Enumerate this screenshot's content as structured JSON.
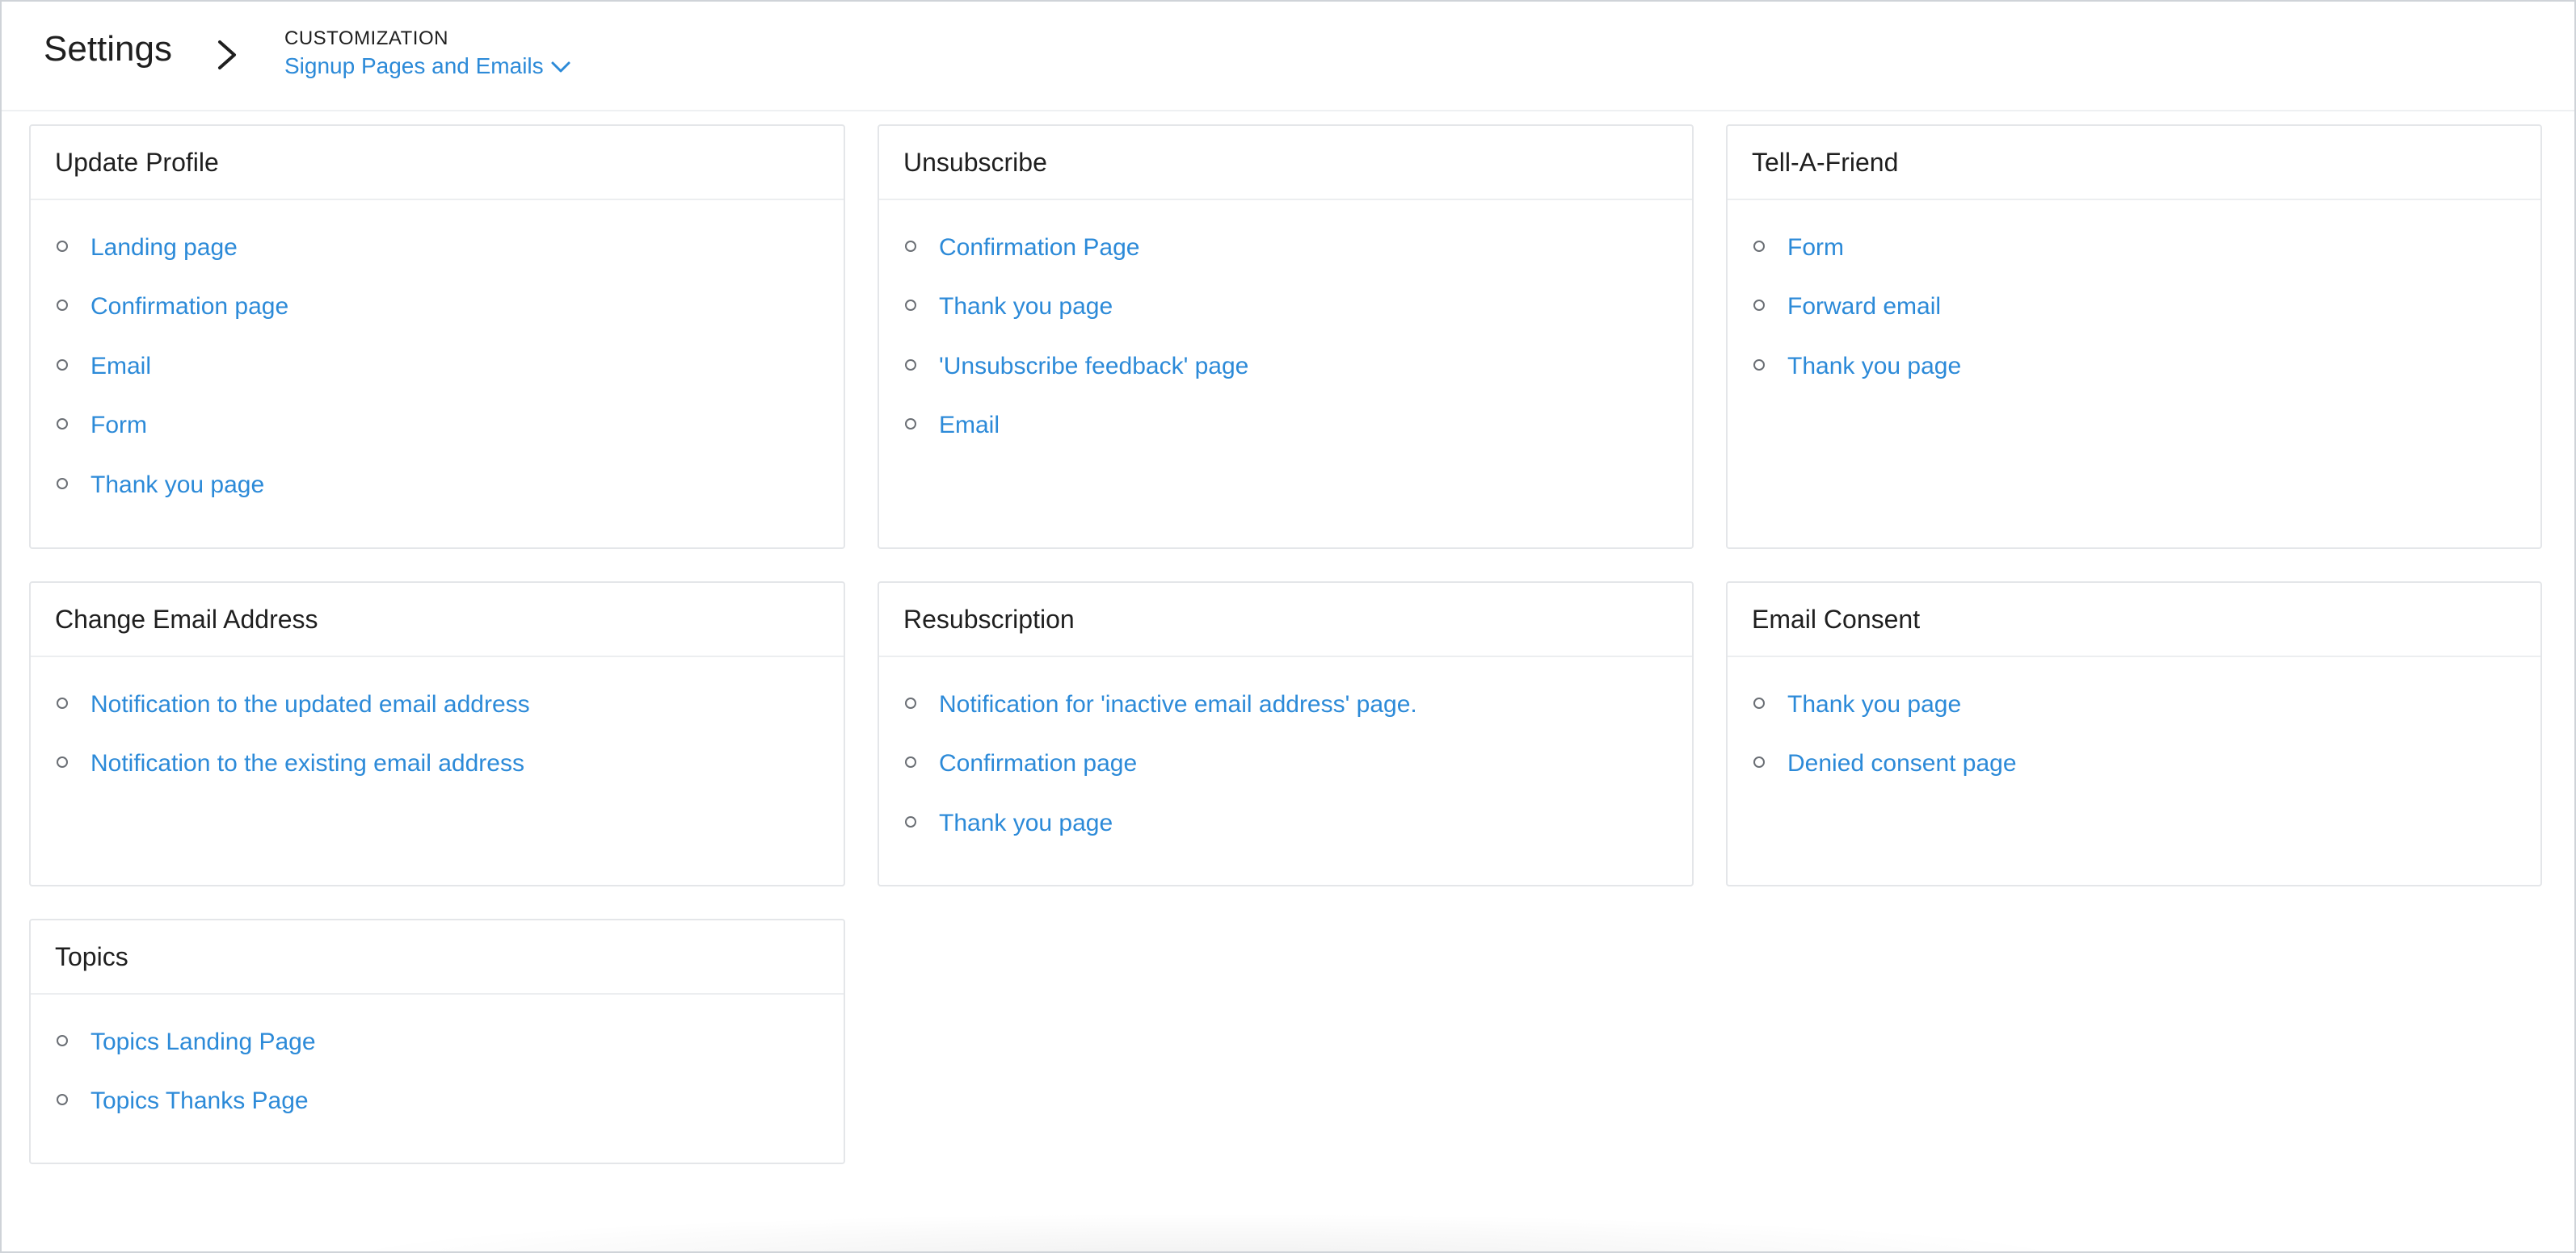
{
  "header": {
    "title": "Settings",
    "breadcrumb_section": "CUSTOMIZATION",
    "breadcrumb_current": "Signup Pages and Emails"
  },
  "accent_color": "#2c8ad8",
  "cards": [
    {
      "title": "Update Profile",
      "items": [
        "Landing page",
        "Confirmation page",
        "Email",
        "Form",
        "Thank you page"
      ]
    },
    {
      "title": "Unsubscribe",
      "items": [
        "Confirmation Page",
        "Thank you page",
        "'Unsubscribe feedback' page",
        "Email"
      ]
    },
    {
      "title": "Tell-A-Friend",
      "items": [
        "Form",
        "Forward email",
        "Thank you page"
      ]
    },
    {
      "title": "Change Email Address",
      "items": [
        "Notification to the updated email address",
        "Notification to the existing email address"
      ]
    },
    {
      "title": "Resubscription",
      "items": [
        "Notification for 'inactive email address' page.",
        "Confirmation page",
        "Thank you page"
      ]
    },
    {
      "title": "Email Consent",
      "items": [
        "Thank you page",
        "Denied consent page"
      ]
    },
    {
      "title": "Topics",
      "items": [
        "Topics Landing Page",
        "Topics Thanks Page"
      ]
    }
  ]
}
